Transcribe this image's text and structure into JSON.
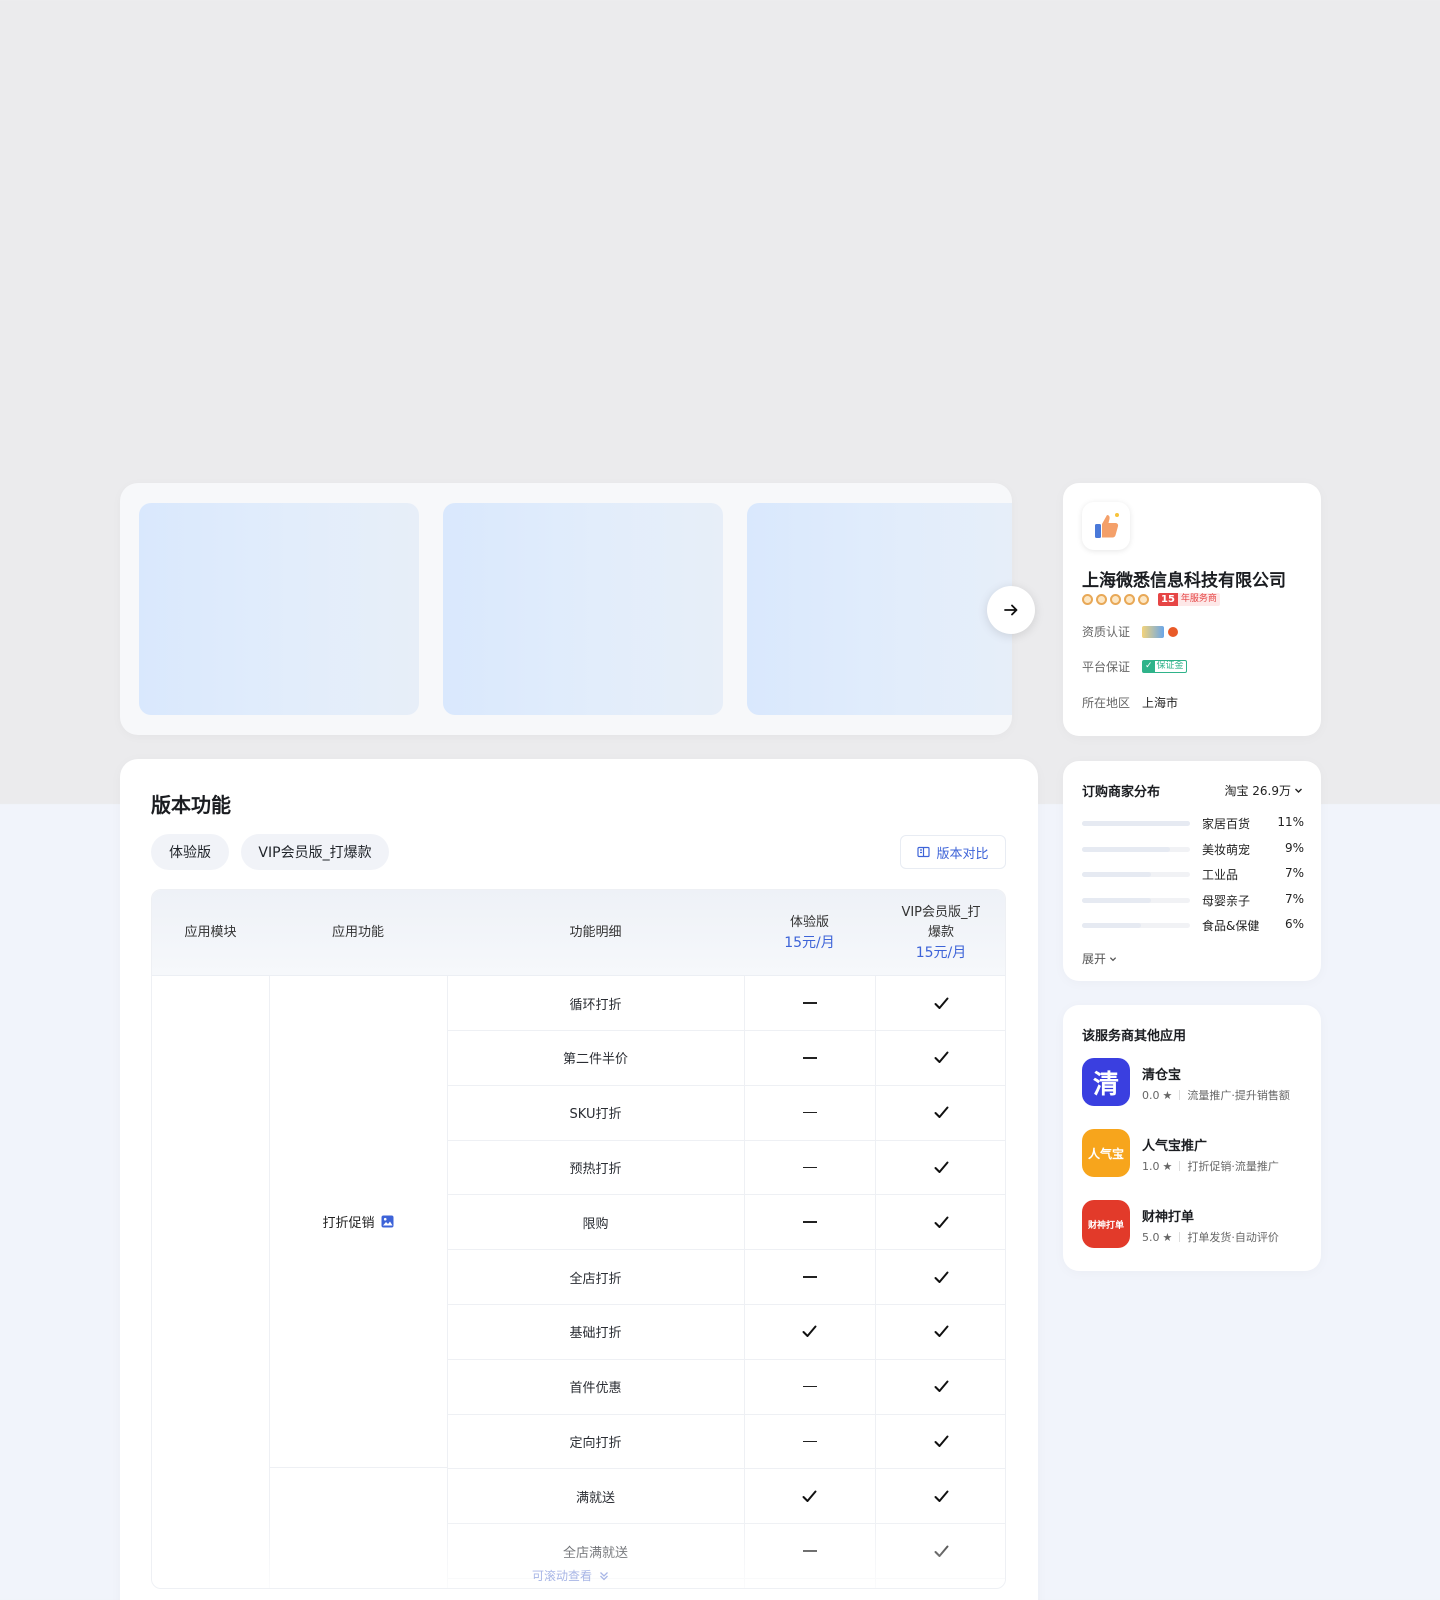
{
  "version_panel": {
    "title": "版本功能",
    "tabs": [
      "体验版",
      "VIP会员版_打爆款"
    ],
    "compare_label": "版本对比",
    "table": {
      "headers": {
        "module": "应用模块",
        "feature": "应用功能",
        "detail": "功能明细",
        "plan1_name": "体验版",
        "plan1_price": "15元/月",
        "plan2_name": "VIP会员版_打爆款",
        "plan2_price": "15元/月"
      },
      "feature_group": "打折促销",
      "rows": [
        {
          "detail": "循环打折",
          "plan1": false,
          "plan2": true
        },
        {
          "detail": "第二件半价",
          "plan1": false,
          "plan2": true
        },
        {
          "detail": "SKU打折",
          "plan1": false,
          "plan2": true
        },
        {
          "detail": "预热打折",
          "plan1": false,
          "plan2": true
        },
        {
          "detail": "限购",
          "plan1": false,
          "plan2": true
        },
        {
          "detail": "全店打折",
          "plan1": false,
          "plan2": true
        },
        {
          "detail": "基础打折",
          "plan1": true,
          "plan2": true
        },
        {
          "detail": "首件优惠",
          "plan1": false,
          "plan2": true
        },
        {
          "detail": "定向打折",
          "plan1": false,
          "plan2": true
        },
        {
          "detail": "满就送",
          "plan1": true,
          "plan2": true
        },
        {
          "detail": "全店满就送",
          "plan1": false,
          "plan2": true
        }
      ],
      "scroll_hint": "可滚动查看"
    }
  },
  "provider": {
    "name": "上海微悉信息科技有限公司",
    "years": "15",
    "years_label": "年服务商",
    "qualification_label": "资质认证",
    "guarantee_label": "平台保证",
    "guarantee_badge": "保证金",
    "region_label": "所在地区",
    "region_value": "上海市"
  },
  "distribution": {
    "title": "订购商家分布",
    "platform_select": "淘宝 26.9万",
    "items": [
      {
        "name": "家居百货",
        "pct": "11%",
        "value": 11
      },
      {
        "name": "美妆萌宠",
        "pct": "9%",
        "value": 9
      },
      {
        "name": "工业品",
        "pct": "7%",
        "value": 7
      },
      {
        "name": "母婴亲子",
        "pct": "7%",
        "value": 7
      },
      {
        "name": "食品&保健",
        "pct": "6%",
        "value": 6
      }
    ],
    "expand_label": "展开"
  },
  "other_apps": {
    "title": "该服务商其他应用",
    "apps": [
      {
        "name": "清仓宝",
        "rating": "0.0",
        "desc": "流量推广·提升销售额",
        "icon_text": "清",
        "color": "#3a3fe0"
      },
      {
        "name": "人气宝推广",
        "rating": "1.0",
        "desc": "打折促销·流量推广",
        "icon_text": "人气宝",
        "color": "#f7a51c"
      },
      {
        "name": "财神打单",
        "rating": "5.0",
        "desc": "打单发货·自动评价",
        "icon_text": "财神打单",
        "color": "#e23a2a"
      }
    ]
  }
}
